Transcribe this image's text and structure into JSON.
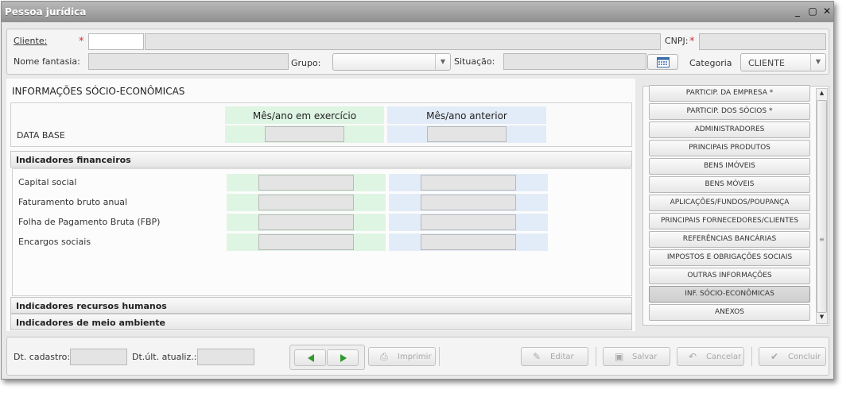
{
  "window": {
    "title": "Pessoa jurídica"
  },
  "header": {
    "cliente_label": "Cliente:",
    "cnpj_label": "CNPJ:",
    "required_mark": "*",
    "nome_fantasia_label": "Nome fantasia:",
    "grupo_label": "Grupo:",
    "situacao_label": "Situação:",
    "categoria_label": "Categoria",
    "categoria_value": "CLIENTE"
  },
  "section": {
    "title": "INFORMAÇÕES SÓCIO-ECONÔMICAS",
    "col_current": "Mês/ano em exercício",
    "col_previous": "Mês/ano anterior",
    "data_base_label": "DATA BASE"
  },
  "financeiros": {
    "title": "Indicadores financeiros",
    "rows": [
      "Capital social",
      "Faturamento bruto anual",
      "Folha de Pagamento Bruta (FBP)",
      "Encargos sociais"
    ]
  },
  "rh": {
    "title": "Indicadores recursos humanos"
  },
  "meio": {
    "title": "Indicadores de meio ambiente"
  },
  "nav": {
    "items": [
      "PARTICIP. DA EMPRESA *",
      "PARTICIP. DOS SÓCIOS *",
      "ADMINISTRADORES",
      "PRINCIPAIS PRODUTOS",
      "BENS IMÓVEIS",
      "BENS MÓVEIS",
      "APLICAÇÕES/FUNDOS/POUPANÇA",
      "PRINCIPAIS FORNECEDORES/CLIENTES",
      "REFERÊNCIAS BANCÁRIAS",
      "IMPOSTOS E OBRIGAÇÕES SOCIAIS",
      "OUTRAS INFORMAÇÕES",
      "INF. SÓCIO-ECONÔMICAS",
      "ANEXOS"
    ],
    "active_index": 11
  },
  "footer": {
    "dt_cadastro_label": "Dt. cadastro:",
    "dt_atualiz_label": "Dt.últ. atualiz.:",
    "imprimir": "Imprimir",
    "editar": "Editar",
    "salvar": "Salvar",
    "cancelar": "Cancelar",
    "concluir": "Concluir"
  },
  "colors": {
    "accent_green": "#2f9a2f",
    "current_col_bg": "#dff5e3",
    "previous_col_bg": "#e2ecf8",
    "required": "#d03030"
  }
}
